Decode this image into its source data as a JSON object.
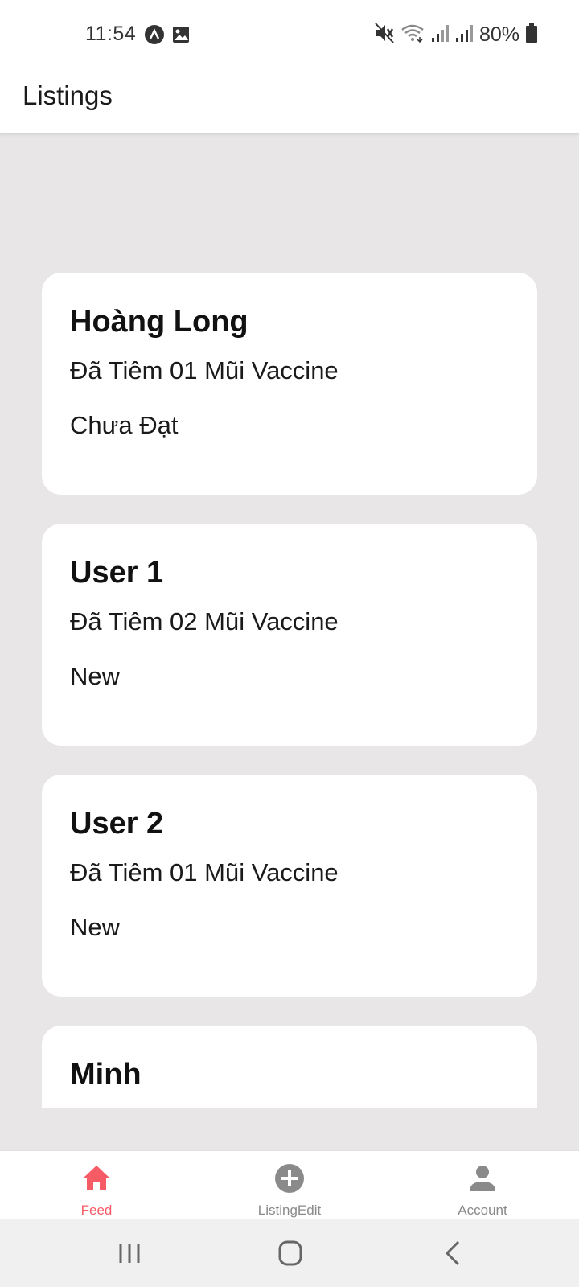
{
  "status_bar": {
    "time": "11:54",
    "battery": "80%",
    "icons": [
      "a-circle-icon",
      "image-icon",
      "mute-icon",
      "wifi-icon",
      "signal-icon",
      "signal-icon",
      "battery-icon"
    ]
  },
  "header": {
    "title": "Listings"
  },
  "listings": [
    {
      "name": "Hoàng Long",
      "description": "Đã Tiêm 01 Mũi Vaccine",
      "status": "Chưa Đạt"
    },
    {
      "name": "User 1",
      "description": "Đã Tiêm 02 Mũi Vaccine",
      "status": "New"
    },
    {
      "name": "User 2",
      "description": "Đã Tiêm 01 Mũi Vaccine",
      "status": "New"
    },
    {
      "name": "Minh"
    }
  ],
  "tabs": [
    {
      "label": "Feed",
      "icon": "home-icon",
      "active": true
    },
    {
      "label": "ListingEdit",
      "icon": "plus-circle-icon",
      "active": false
    },
    {
      "label": "Account",
      "icon": "person-icon",
      "active": false
    }
  ],
  "colors": {
    "accent": "#f75c66",
    "background": "#e8e6e7",
    "card": "#ffffff",
    "inactive": "#8a8a8a"
  }
}
